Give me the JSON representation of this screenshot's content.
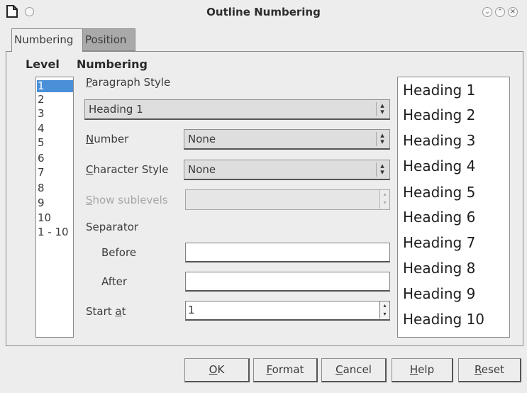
{
  "window": {
    "title": "Outline Numbering",
    "icon": "document-icon",
    "controls": [
      "minimize-icon",
      "maximize-icon",
      "close-icon"
    ]
  },
  "tabs": [
    {
      "label": "Numbering",
      "active": true
    },
    {
      "label": "Position",
      "active": false
    }
  ],
  "level": {
    "heading": "Level",
    "items": [
      "1",
      "2",
      "3",
      "4",
      "5",
      "6",
      "7",
      "8",
      "9",
      "10",
      "1 - 10"
    ],
    "selected": "1"
  },
  "numbering": {
    "heading": "Numbering",
    "paragraph_style_label_first": "P",
    "paragraph_style_label_rest": "aragraph Style",
    "paragraph_style_value": "Heading 1",
    "number_label_first": "N",
    "number_label_rest": "umber",
    "number_value": "None",
    "character_style_label_first": "C",
    "character_style_label_rest": "haracter Style",
    "character_style_value": "None",
    "show_sublevels_label_first": "S",
    "show_sublevels_label_rest": "how sublevels",
    "show_sublevels_value": "",
    "separator_label": "Separator",
    "before_label": "Before",
    "before_value": "",
    "after_label": "After",
    "after_value": "",
    "start_at_label_pre": "Start ",
    "start_at_label_u": "a",
    "start_at_label_post": "t",
    "start_at_value": "1"
  },
  "preview": [
    "Heading 1",
    "Heading 2",
    "Heading 3",
    "Heading 4",
    "Heading 5",
    "Heading 6",
    "Heading 7",
    "Heading 8",
    "Heading 9",
    "Heading 10"
  ],
  "buttons": {
    "ok_u": "O",
    "ok_rest": "K",
    "format_u": "F",
    "format_rest": "ormat",
    "cancel_u": "C",
    "cancel_rest": "ancel",
    "help_u": "H",
    "help_rest": "elp",
    "reset_u": "R",
    "reset_rest": "eset"
  },
  "colors": {
    "selection": "#4a90d9",
    "window_bg": "#ededed"
  }
}
